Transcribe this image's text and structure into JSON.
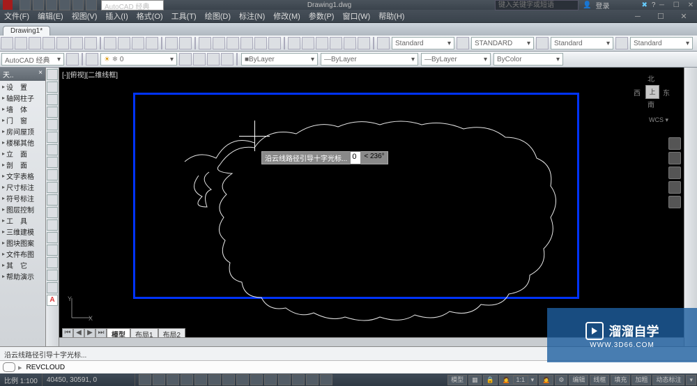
{
  "title_bar": {
    "document_name": "Drawing1.dwg",
    "search_placeholder": "键入关键字或短语",
    "login_text": "登录"
  },
  "quick_workspace": "AutoCAD 经典",
  "menus": [
    "文件(F)",
    "编辑(E)",
    "视图(V)",
    "插入(I)",
    "格式(O)",
    "工具(T)",
    "绘图(D)",
    "标注(N)",
    "修改(M)",
    "参数(P)",
    "窗口(W)",
    "帮助(H)"
  ],
  "doc_tab": "Drawing1*",
  "props_row": {
    "workspace": "AutoCAD 经典",
    "style1": "Standard",
    "style2": "STANDARD",
    "style3": "Standard",
    "style4": "Standard",
    "layer": "0"
  },
  "layer_row": {
    "bylayer1": "ByLayer",
    "bylayer2": "ByLayer",
    "bylayer3": "ByLayer",
    "bycolor": "ByColor"
  },
  "palette": {
    "title": "天..",
    "items": [
      "设　置",
      "轴网柱子",
      "墙　体",
      "门　窗",
      "房间屋顶",
      "楼梯其他",
      "立　面",
      "剖　面",
      "文字表格",
      "尺寸标注",
      "符号标注",
      "图层控制",
      "工　具",
      "三维建模",
      "图块图案",
      "文件布图",
      "其　它",
      "帮助演示"
    ]
  },
  "canvas": {
    "viewport_label": "[-][俯视][二维线框]",
    "viewcube": {
      "top": "北",
      "left": "西",
      "right": "东",
      "bottom": "南",
      "face": "上",
      "wcs": "WCS ▾"
    },
    "dynamic_input": {
      "prompt": "沿云线路径引导十字光标...",
      "val1": "0",
      "angle": "236°"
    }
  },
  "layout_tabs": {
    "model": "模型",
    "layout1": "布局1",
    "layout2": "布局2"
  },
  "command": {
    "history": "沿云线路径引导十字光标...",
    "prompt_glyph": "▸",
    "text": "REVCLOUD"
  },
  "status": {
    "scale_label": "比例 1:100",
    "coords": "40450, 30591, 0",
    "model": "模型",
    "anno": "1:1",
    "drafting": [
      "编辑",
      "线框",
      "填充",
      "加粗",
      "动态标注"
    ],
    "people": "人"
  },
  "watermark": {
    "brand": "溜溜自学",
    "url": "WWW.3D66.COM"
  }
}
